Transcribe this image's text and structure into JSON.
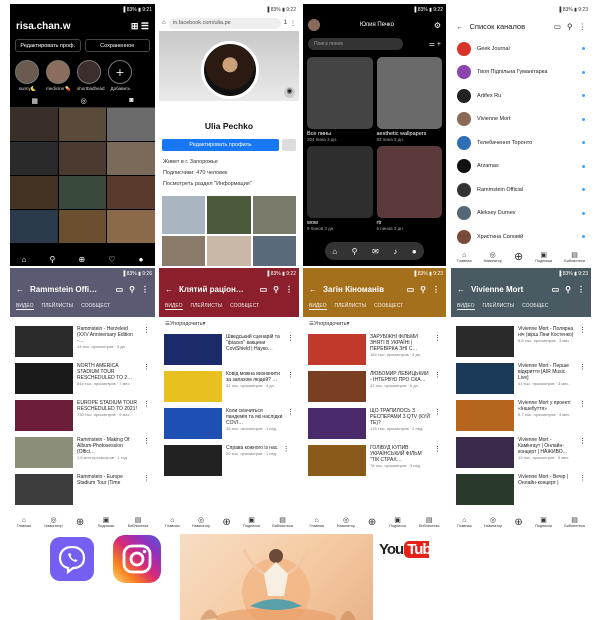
{
  "instagram": {
    "username": "risa.chan.w",
    "status": "▐ 83% ▮ 9:21",
    "edit_profile": "Редактировать проф.",
    "saved": "Сохраненное",
    "highlights": [
      "sunny🌜",
      "medicine 💊",
      "shortbadhead",
      "Добавить"
    ]
  },
  "facebook": {
    "status": "▐ 83% ▮ 9:22",
    "url": "m.facebook.com/ulia.pe",
    "tab_count": "1",
    "name": "Ulia Pechko",
    "edit_profile": "Редактировать профиль",
    "lives": "Живет в г. Запорожье",
    "followers": "Подписчики: 470 человек",
    "info": "Посмотреть раздел \"Информация\""
  },
  "pinterest": {
    "status": "▐ 83% ▮ 9:22",
    "name": "Юлия Печко",
    "search": "Поиск пинов",
    "boards": [
      {
        "title": "Все пины",
        "sub": "204 пина  3 дн."
      },
      {
        "title": "aesthetic wallpapers",
        "sub": "83 пина  3 дн."
      },
      {
        "title": "wow",
        "sub": "9 пинов  3 дн."
      },
      {
        "title": "rtr",
        "sub": "6 пинов  3 дн."
      }
    ]
  },
  "channels": {
    "status": "▐ 83% ▮ 9:23",
    "title": "Список каналов",
    "items": [
      {
        "name": "Geek Journal",
        "color": "#d9342b"
      },
      {
        "name": "Твоя Підпільна Гуманітарка",
        "color": "#8e44ad"
      },
      {
        "name": "Artifex Ru",
        "color": "#222222"
      },
      {
        "name": "Vivienne Mort",
        "color": "#8a6a55"
      },
      {
        "name": "Телебачення Торонто",
        "color": "#2f6fb5"
      },
      {
        "name": "Arzamas",
        "color": "#111111"
      },
      {
        "name": "Rammstein Official",
        "color": "#333333"
      },
      {
        "name": "Aleksey Durnev",
        "color": "#556677"
      },
      {
        "name": "Христина Соловій",
        "color": "#7a4b3a"
      }
    ]
  },
  "ytnav": [
    "Главная",
    "Навигатор",
    "",
    "Подписки",
    "Библиотека"
  ],
  "ytpanels": [
    {
      "title": "Rammstein Offi…",
      "status": "▐ 83% ▮ 9:26",
      "color": "#5b5a73",
      "tabs": [
        "ВИДЕО",
        "ПЛЕЙЛИСТЫ",
        "СООБЩЕСТ"
      ],
      "sort": "",
      "videos": [
        {
          "title": "Rammstein - Herzeleid (XXV Anniversary Edition -…",
          "views": "13 тыс. просмотров · 3 дн.",
          "bg": "#2b2b2b"
        },
        {
          "title": "NORTH AMERICA STADIUM TOUR RESCHEDULED TO 2…",
          "views": "844 тыс. просмотров · 7 мес.",
          "bg": "#1a1a1a"
        },
        {
          "title": "EUROPE STADIUM TOUR RESCHEDULED TO 2021!",
          "views": "730 тыс. просмотров · 9 мес.",
          "bg": "#6b1d3a"
        },
        {
          "title": "Rammstein - Making Of Album-Photosession (Offici…",
          "views": "1,6 млн просмотров · 1 год",
          "bg": "#8b8f7a"
        },
        {
          "title": "Rammstein - Europe Stadium Tour (Time",
          "views": "",
          "bg": "#3d3d3d"
        }
      ]
    },
    {
      "title": "Клятий раціон…",
      "status": "▐ 83% ▮ 9:22",
      "color": "#8b1f2b",
      "tabs": [
        "ВИДЕО",
        "ПЛЕЙЛИСТЫ",
        "СООБЩЕСТ"
      ],
      "sort": "Упорядочить",
      "videos": [
        {
          "title": "Шведський сценарій та \"фіаско\" вакцини CoviShield | Науко…",
          "views": "",
          "bg": "#1b2a6b"
        },
        {
          "title": "Ковід можна визначити за запахом людей? …",
          "views": "32 тыс. просмотров · 4 дн.",
          "bg": "#e8c020"
        },
        {
          "title": "Коли скінчиться пандемія та які наслідки COVI…",
          "views": "38 тыс. просмотров · 1 нед.",
          "bg": "#1e4fb3"
        },
        {
          "title": "Справа кожного із нас.",
          "views": "20 тыс. просмотров · 1 нед.",
          "bg": "#222222"
        }
      ]
    },
    {
      "title": "Загін Кіноманів",
      "status": "▐ 83% ▮ 9:23",
      "color": "#a5701c",
      "tabs": [
        "ВИДЕО",
        "ПЛЕЙЛИСТЫ",
        "СООБЩЕСТ"
      ],
      "sort": "Упорядочить",
      "videos": [
        {
          "title": "ЗАРУБІЖНІ ФІЛЬМИ ЗНЯТІ В УКРАЇНІ | ПЕРЕВІРКА ЗНІ С…",
          "views": "184 тыс. просмотров · 3 дн.",
          "bg": "#c0392b"
        },
        {
          "title": "ЛЮБОМИР ЛЕВИЦЬКИЙ - ІНТЕРВ’Ю ПРО СКА…",
          "views": "43 тыс. просмотров · 6 дн.",
          "bg": "#7a3f22"
        },
        {
          "title": "ЩО ТРАПИЛОСЬ З РЕСПЕРАМИ 3 QTV (КУЙ ТЕ)?",
          "views": "176 тыс. просмотров · 2 нед.",
          "bg": "#4b2a6b"
        },
        {
          "title": "ГОЛІВУД КУПИВ УКРАЇНСЬКИЙ ФІЛЬМ \"ТІК СТРАХ…",
          "views": "78 тыс. просмотров · 3 нед.",
          "bg": "#8a5a1a"
        }
      ]
    },
    {
      "title": "Vivienne Mort",
      "status": "▐ 83% ▮ 9:23",
      "color": "#4a5a63",
      "tabs": [
        "ВИДЕО",
        "ПЛЕЙЛИСТЫ",
        "СООБЩЕС"
      ],
      "sort": "",
      "videos": [
        {
          "title": "Vivienne Mort - Полярна ніч (вірш Ліни Костенко)",
          "views": "8,8 тыс. просмотров · 3 мес.",
          "bg": "#2a2a2a"
        },
        {
          "title": "Vivienne Mort - Перше відкриття [AIR Music Live]",
          "views": "41 тыс. просмотров · 3 мес.",
          "bg": "#1b3a5a"
        },
        {
          "title": "Vivienne Mort у проекті «Іншебуття»",
          "views": "5,7 тыс. просмотров · 4 мес.",
          "bg": "#b5651d"
        },
        {
          "title": "Vivienne Mort - Камінгаут | Онлайн-концерт | НАЖИВО...",
          "views": "13 тыс. просмотров · 5 мес.",
          "bg": "#3a2a4a"
        },
        {
          "title": "Vivienne Mort - Вечір | Онлайн-концерт |",
          "views": "",
          "bg": "#2a3a2a"
        }
      ]
    }
  ],
  "youtube_logo": {
    "you": "You",
    "tube": "Tube"
  }
}
